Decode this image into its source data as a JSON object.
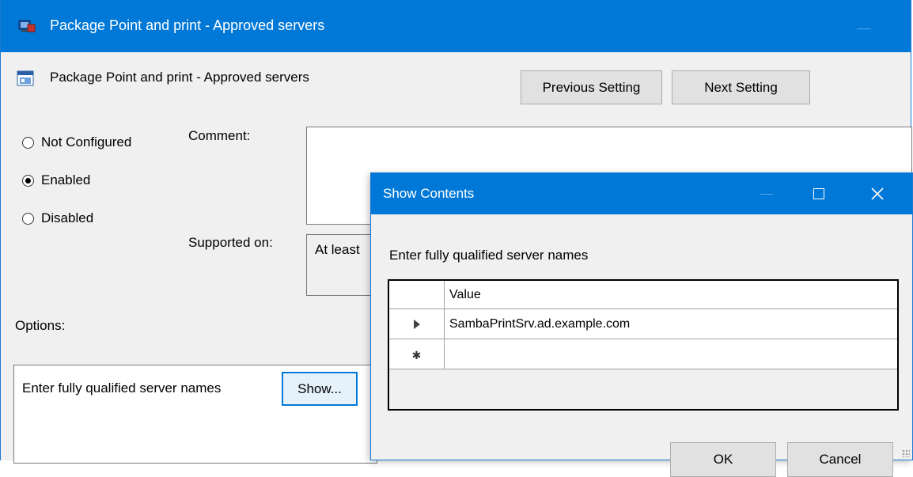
{
  "window": {
    "title": "Package Point and print - Approved servers"
  },
  "setting": {
    "title": "Package Point and print - Approved servers",
    "previous_label": "Previous Setting",
    "next_label": "Next Setting"
  },
  "state": {
    "options": [
      {
        "label": "Not Configured",
        "checked": false
      },
      {
        "label": "Enabled",
        "checked": true
      },
      {
        "label": "Disabled",
        "checked": false
      }
    ]
  },
  "fields": {
    "comment_label": "Comment:",
    "comment_value": "",
    "supported_label": "Supported on:",
    "supported_value": "At least"
  },
  "options": {
    "label": "Options:",
    "text": "Enter fully qualified server names",
    "show_label": "Show..."
  },
  "dialog": {
    "title": "Show Contents",
    "prompt": "Enter fully qualified server names",
    "column_header": "Value",
    "rows": [
      {
        "marker": "current-row-icon",
        "value": "SambaPrintSrv.ad.example.com"
      },
      {
        "marker": "new-row-icon",
        "value": ""
      }
    ],
    "ok_label": "OK",
    "cancel_label": "Cancel"
  },
  "colors": {
    "titlebar": "#0078d7",
    "window_bg": "#f0f0f0",
    "button_bg": "#e1e1e1"
  }
}
